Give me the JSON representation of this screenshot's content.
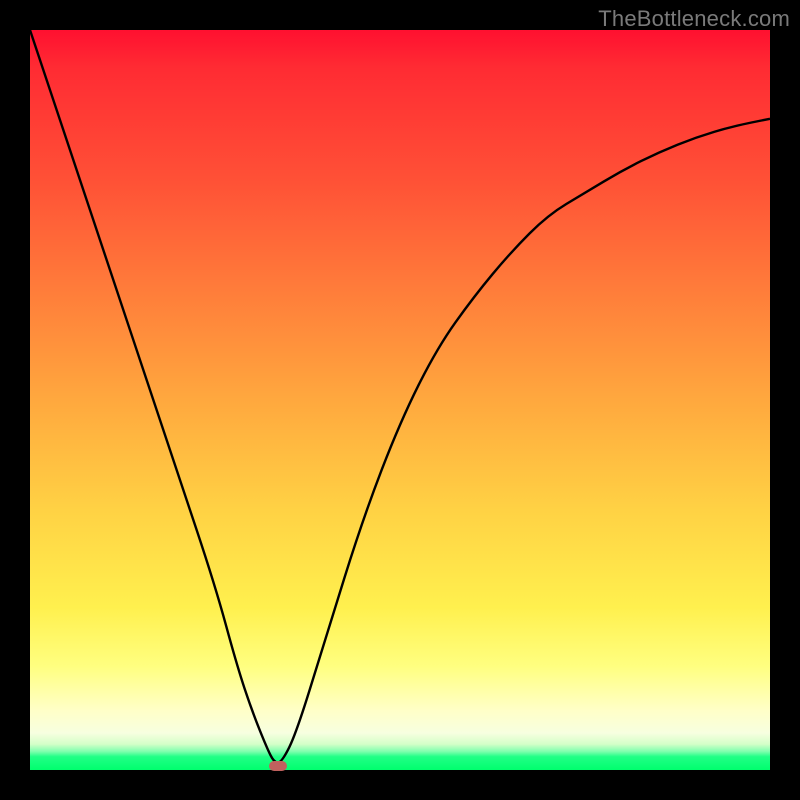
{
  "watermark": "TheBottleneck.com",
  "colors": {
    "frame": "#000000",
    "curve": "#000000",
    "marker": "#c0615e",
    "gradient_top": "#ff1030",
    "gradient_bottom": "#00ff6e"
  },
  "chart_data": {
    "type": "line",
    "title": "",
    "xlabel": "",
    "ylabel": "",
    "xlim": [
      0,
      100
    ],
    "ylim": [
      0,
      100
    ],
    "series": [
      {
        "name": "bottleneck-curve",
        "x": [
          0,
          5,
          10,
          15,
          20,
          25,
          28,
          30,
          32,
          33,
          34,
          36,
          40,
          45,
          50,
          55,
          60,
          65,
          70,
          75,
          80,
          85,
          90,
          95,
          100
        ],
        "values": [
          100,
          85,
          70,
          55,
          40,
          25,
          14,
          8,
          3,
          1,
          1,
          5,
          18,
          34,
          47,
          57,
          64,
          70,
          75,
          78,
          81,
          83.5,
          85.5,
          87,
          88
        ]
      }
    ],
    "annotations": [
      {
        "name": "optimum-marker",
        "x": 33.5,
        "y": 0.5
      }
    ]
  }
}
